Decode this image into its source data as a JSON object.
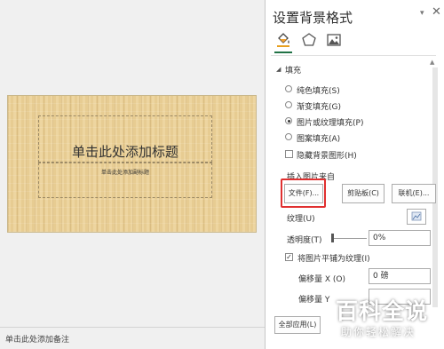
{
  "slide": {
    "title_placeholder": "单击此处添加标题",
    "subtitle_placeholder": "单击此处添加副标题",
    "notes_placeholder": "单击此处添加备注"
  },
  "pane": {
    "title": "设置背景格式",
    "dropdown_glyph": "▾",
    "close_glyph": "✕",
    "tabs": [
      {
        "icon": "fill-bucket-icon",
        "active": true
      },
      {
        "icon": "pentagon-effects-icon",
        "active": false
      },
      {
        "icon": "picture-icon",
        "active": false
      }
    ],
    "fill_section": {
      "title": "填充",
      "options": [
        {
          "label": "纯色填充(S)",
          "selected": false
        },
        {
          "label": "渐变填充(G)",
          "selected": false
        },
        {
          "label": "图片或纹理填充(P)",
          "selected": true
        },
        {
          "label": "图案填充(A)",
          "selected": false
        }
      ],
      "hide_bg_graphics": {
        "label": "隐藏背景图形(H)",
        "checked": false
      },
      "insert_from_label": "插入图片来自",
      "buttons": {
        "file": "文件(F)...",
        "clipboard": "剪贴板(C)",
        "online": "联机(E)..."
      },
      "texture_label": "纹理(U)",
      "transparency_label": "透明度(T)",
      "transparency_value": "0%",
      "tile_checkbox": {
        "label": "将图片平铺为纹理(I)",
        "checked": true
      },
      "offset_x": {
        "label": "偏移量 X (O)",
        "value": "0 磅"
      },
      "offset_y": {
        "label": "偏移量 Y",
        "value": ""
      }
    },
    "apply_all_label": "全部应用(L)"
  },
  "watermark": {
    "main": "百科全说",
    "sub": "助你轻松解决"
  },
  "colors": {
    "accent": "#217346",
    "highlight": "#e03030",
    "slide_bg": "#e7cc92"
  }
}
